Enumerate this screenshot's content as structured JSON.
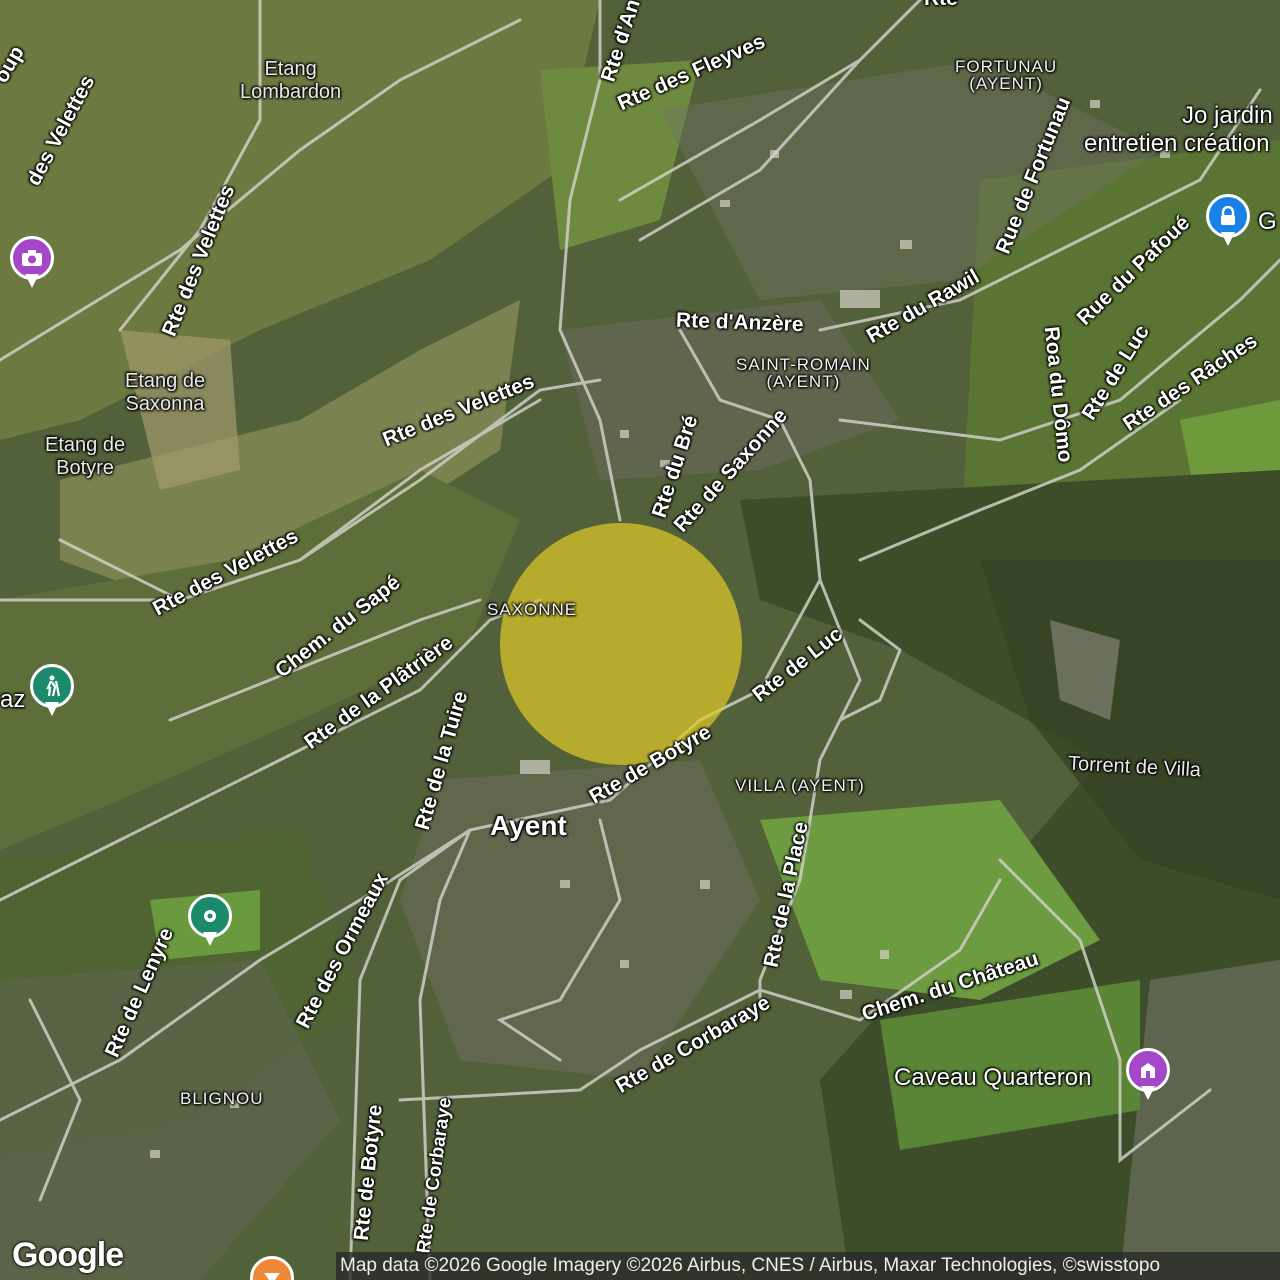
{
  "map": {
    "type": "satellite",
    "highlight_color": "#dcc828",
    "road_color": "#cfcfc6"
  },
  "places": {
    "fortunau": "FORTUNAU\n(AYENT)",
    "saint_romain": "SAINT-ROMAIN\n(AYENT)",
    "saxonne": "SAXONNE",
    "villa": "VILLA (AYENT)",
    "blignou": "BLIGNOU",
    "ayent": "Ayent"
  },
  "areas": {
    "etang_lombardon": "Etang\nLombardon",
    "etang_saxonna": "Etang de\nSaxonna",
    "etang_botyre": "Etang de\nBotyre",
    "torrent_villa": "Torrent de Villa"
  },
  "roads": {
    "velettes_1": "des Velettes",
    "velettes_2": "Rte des Velettes",
    "velettes_3": "Rte des Velettes",
    "velettes_4": "Rte des Velettes",
    "velettes_5": "Rte des Velettes",
    "anzere_top": "Rte d'An",
    "fleyves": "Rte des Fleyves",
    "anzere": "Rte d'Anzère",
    "rawil": "Rte du Rawil",
    "fortunau": "Rue de Fortunau",
    "pafoue": "Rue du Pafoué",
    "domo": "Roa du Dômo",
    "luc_ne": "Rte de Luc",
    "raches": "Rte des Râches",
    "bre": "Rte du Bré",
    "saxonne": "Rte de Saxonne",
    "sape": "Chem. du Sapé",
    "platriere": "Rte de la Plâtrière",
    "tuire": "Rte de la Tuire",
    "botyre": "Rte de Botyre",
    "luc": "Rte de Luc",
    "place": "Rte de la Place",
    "chateau": "Chem. du Château",
    "corbaraye": "Rte de Corbaraye",
    "ormeaux": "Rte des Ormeaux",
    "lenyre": "Rte de Lenyre",
    "botyre_s": "Rte de Botyre",
    "corbaraye_s": "Rte de Corbaraye",
    "top_right": "Rte",
    "top_left": "oup"
  },
  "pois": {
    "jo_jardin_line1": "Jo jardin",
    "jo_jardin_line2": "entretien création",
    "g_letter": "G",
    "caveau": "Caveau Quarteron",
    "caveau_color": "#a646c9",
    "camera_color": "#a646c9",
    "hike_color": "#1a8a6b",
    "park_color": "#1a8a6b",
    "lock_color": "#1a82e6",
    "food_color": "#f0883a",
    "az": "az",
    "camera_icon": "camera-icon",
    "hike_icon": "hiking-icon",
    "park_icon": "park-icon",
    "lock_icon": "lock-icon",
    "wine_icon": "wine-icon",
    "food_icon": "food-icon"
  },
  "footer": {
    "logo": "Google",
    "attribution": "Map data ©2026 Google Imagery ©2026 Airbus, CNES / Airbus, Maxar Technologies, ©swisstopo"
  }
}
